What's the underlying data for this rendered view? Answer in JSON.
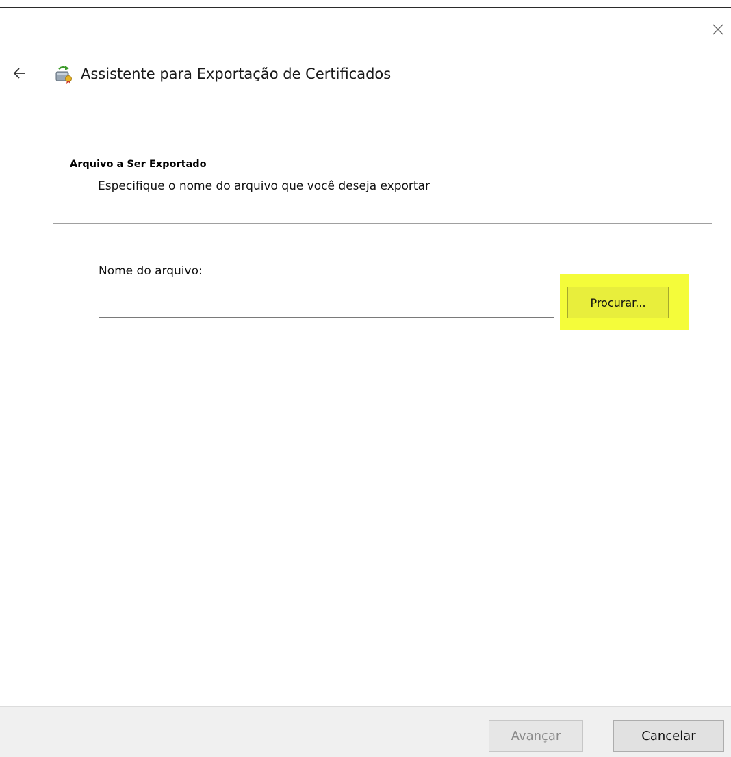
{
  "window": {
    "title": "Assistente para Exportação de Certificados",
    "close_icon": "close-icon",
    "back_icon": "arrow-left-icon",
    "app_icon": "certificate-export-icon"
  },
  "section": {
    "heading": "Arquivo a Ser Exportado",
    "description": "Especifique o nome do arquivo que você deseja exportar"
  },
  "form": {
    "filename_label": "Nome do arquivo:",
    "filename_value": "",
    "browse_label": "Procurar..."
  },
  "footer": {
    "next_label": "Avançar",
    "next_enabled": false,
    "cancel_label": "Cancelar"
  },
  "colors": {
    "highlight": "#f4fc3a",
    "footer_bg": "#f0f0f0",
    "separator": "#a0a0a0"
  }
}
